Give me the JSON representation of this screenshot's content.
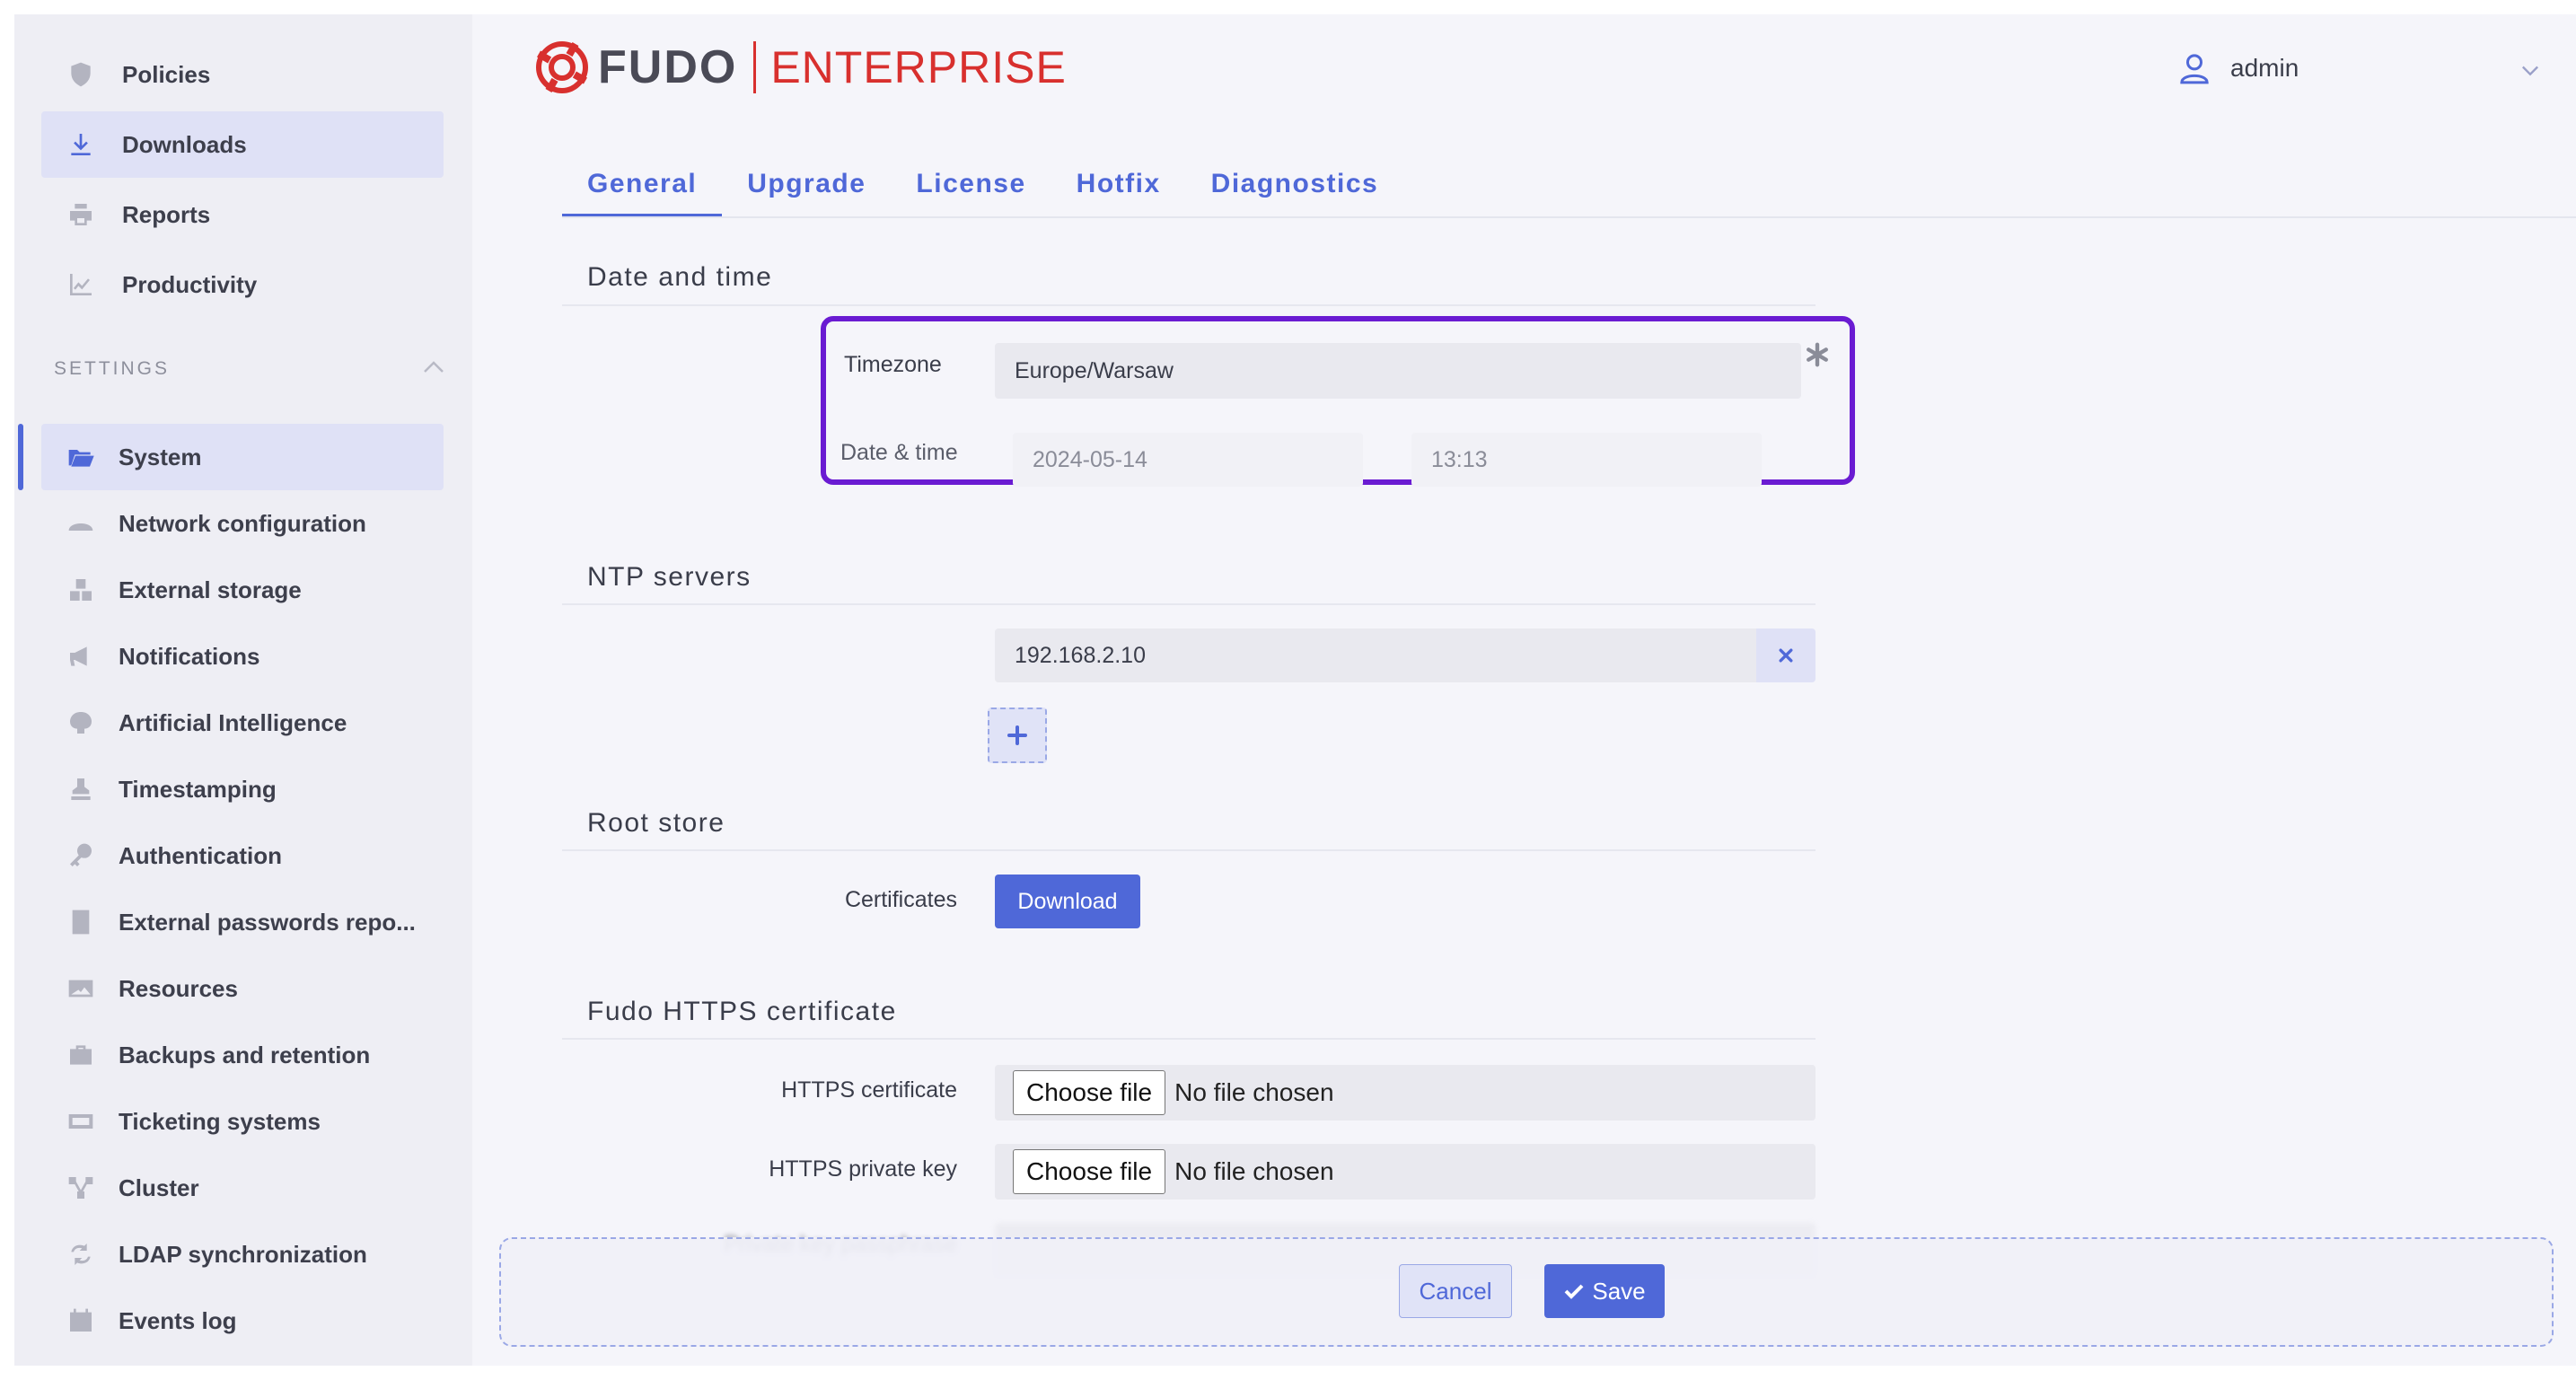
{
  "sidebar": {
    "items": [
      {
        "label": "Policies",
        "icon": "shield-icon"
      },
      {
        "label": "Downloads",
        "icon": "download-icon"
      },
      {
        "label": "Reports",
        "icon": "printer-icon"
      },
      {
        "label": "Productivity",
        "icon": "chart-icon"
      }
    ],
    "settings_header": "SETTINGS",
    "settings_items": [
      {
        "label": "System",
        "icon": "folder-icon"
      },
      {
        "label": "Network configuration",
        "icon": "network-icon"
      },
      {
        "label": "External storage",
        "icon": "storage-icon"
      },
      {
        "label": "Notifications",
        "icon": "megaphone-icon"
      },
      {
        "label": "Artificial Intelligence",
        "icon": "brain-icon"
      },
      {
        "label": "Timestamping",
        "icon": "stamp-icon"
      },
      {
        "label": "Authentication",
        "icon": "key-icon"
      },
      {
        "label": "External passwords repo...",
        "icon": "book-icon"
      },
      {
        "label": "Resources",
        "icon": "image-icon"
      },
      {
        "label": "Backups and retention",
        "icon": "briefcase-icon"
      },
      {
        "label": "Ticketing systems",
        "icon": "ticket-icon"
      },
      {
        "label": "Cluster",
        "icon": "cluster-icon"
      },
      {
        "label": "LDAP synchronization",
        "icon": "sync-icon"
      },
      {
        "label": "Events log",
        "icon": "calendar-icon"
      }
    ]
  },
  "header": {
    "logo_brand": "FUDO",
    "logo_edition": "ENTERPRISE",
    "user_name": "admin"
  },
  "tabs": [
    {
      "label": "General"
    },
    {
      "label": "Upgrade"
    },
    {
      "label": "License"
    },
    {
      "label": "Hotfix"
    },
    {
      "label": "Diagnostics"
    }
  ],
  "date_time": {
    "title": "Date and time",
    "timezone_label": "Timezone",
    "timezone_value": "Europe/Warsaw",
    "datetime_label": "Date & time",
    "date_value": "2024-05-14",
    "time_value": "13:13"
  },
  "ntp": {
    "title": "NTP servers",
    "server_value": "192.168.2.10"
  },
  "root_store": {
    "title": "Root store",
    "certificates_label": "Certificates",
    "download_label": "Download"
  },
  "https_cert": {
    "title": "Fudo HTTPS certificate",
    "certificate_label": "HTTPS certificate",
    "private_key_label": "HTTPS private key",
    "choose_file_label": "Choose file",
    "no_file_label": "No file chosen",
    "passphrase_label": "Private key passphrase"
  },
  "footer": {
    "cancel_label": "Cancel",
    "save_label": "Save"
  },
  "colors": {
    "accent": "#4f68d8",
    "brand_red": "#d8302e",
    "highlight": "#6a1bd2"
  }
}
